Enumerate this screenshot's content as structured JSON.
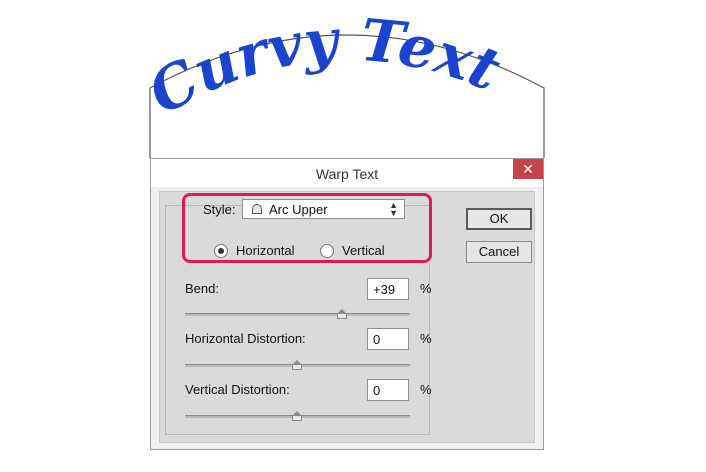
{
  "preview": {
    "text": "Curvy Text",
    "color": "#1a44cc"
  },
  "dialog": {
    "title": "Warp Text",
    "close_glyph": "✕",
    "style_label": "Style:",
    "style_value": "Arc Upper",
    "style_icon": "arc-shape-icon",
    "orientation": {
      "horizontal": "Horizontal",
      "vertical": "Vertical",
      "selected": "Horizontal"
    },
    "bend": {
      "label": "Bend:",
      "value": "+39",
      "unit": "%",
      "percent": 39
    },
    "h_distortion": {
      "label": "Horizontal Distortion:",
      "value": "0",
      "unit": "%",
      "percent": 0
    },
    "v_distortion": {
      "label": "Vertical Distortion:",
      "value": "0",
      "unit": "%",
      "percent": 0
    },
    "ok_label": "OK",
    "cancel_label": "Cancel",
    "highlight_color": "#d81b60"
  }
}
